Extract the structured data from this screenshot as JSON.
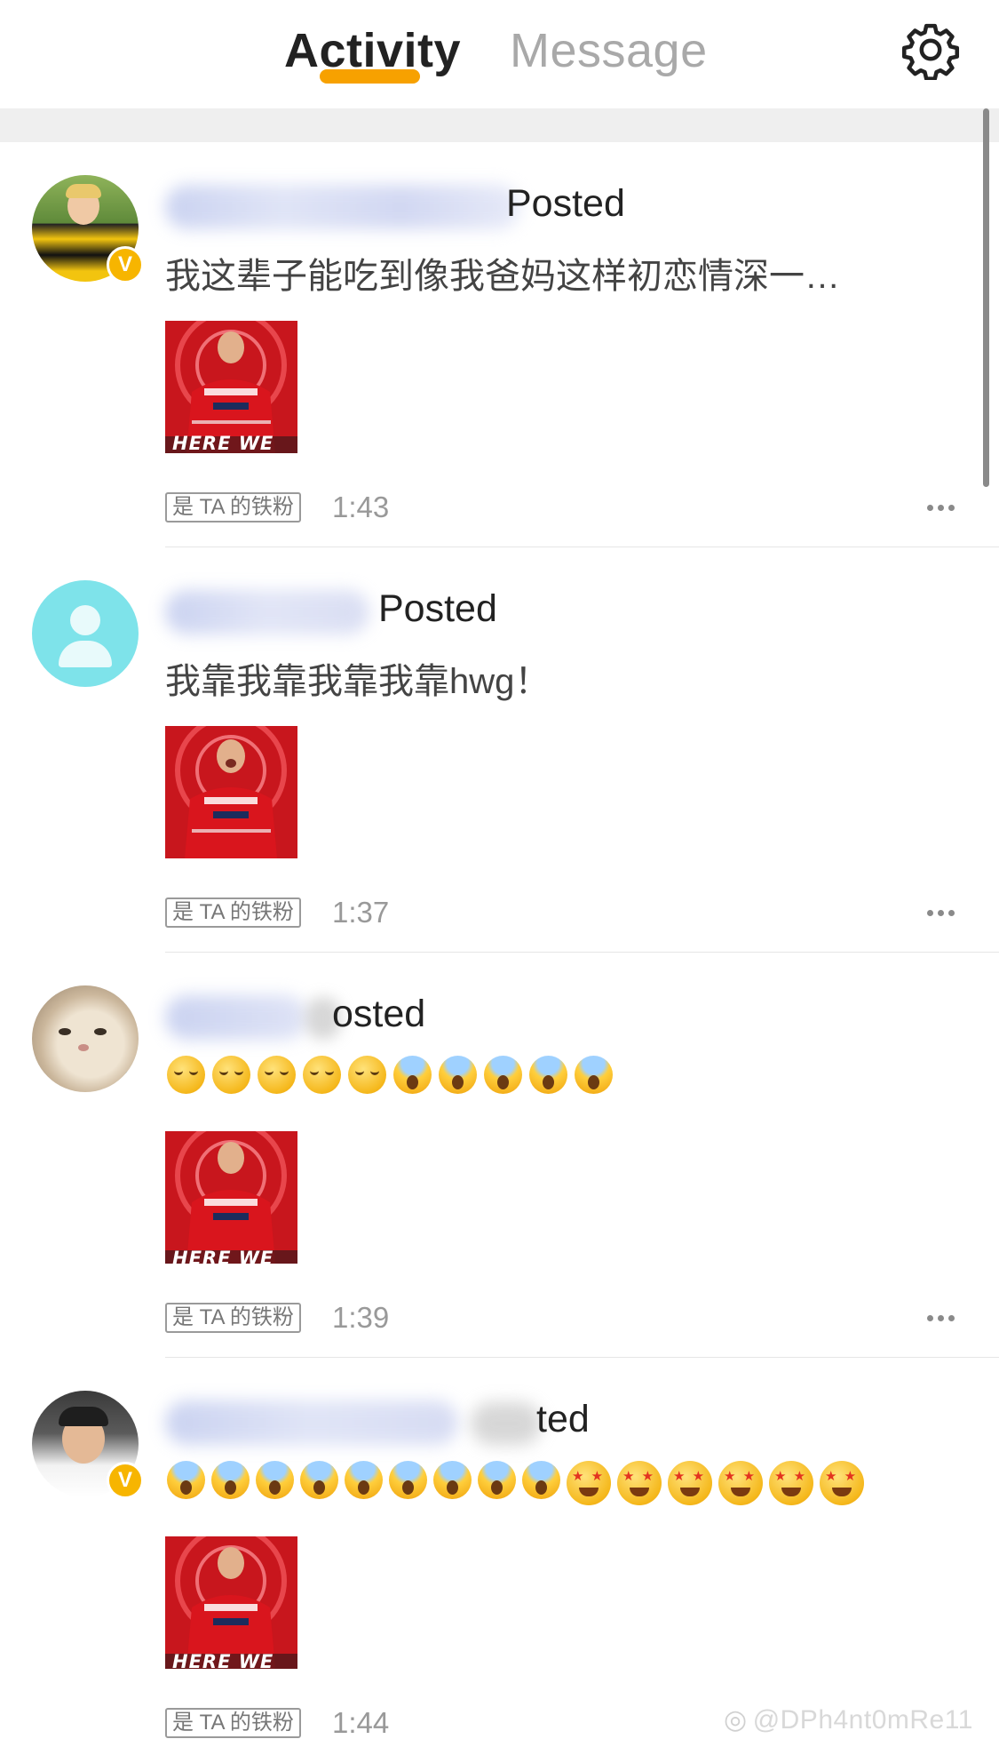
{
  "header": {
    "tabs": [
      {
        "label": "Activity",
        "active": true
      },
      {
        "label": "Message",
        "active": false
      }
    ],
    "settings_icon": "gear-icon",
    "accent_color": "#f7a100"
  },
  "feed": [
    {
      "action": "Posted",
      "content": "我这辈子能吃到像我爸妈这样初恋情深一…",
      "verified": true,
      "fan_badge": "是 TA 的铁粉",
      "time": "1:43",
      "thumb_caption": "HERE WE GO"
    },
    {
      "action": "Posted",
      "content": "我靠我靠我靠我靠hwg！",
      "verified": false,
      "fan_badge": "是 TA 的铁粉",
      "time": "1:37",
      "thumb_caption": ""
    },
    {
      "action": "osted",
      "content_emojis": [
        "crying-face",
        "crying-face",
        "crying-face",
        "crying-face",
        "crying-face",
        "screaming-face",
        "screaming-face",
        "screaming-face",
        "screaming-face",
        "screaming-face"
      ],
      "verified": false,
      "fan_badge": "是 TA 的铁粉",
      "time": "1:39",
      "thumb_caption": "HERE WE GO"
    },
    {
      "action": "ted",
      "content_emojis": [
        "fearful-face",
        "fearful-face",
        "fearful-face",
        "fearful-face",
        "fearful-face",
        "fearful-face",
        "fearful-face",
        "fearful-face",
        "fearful-face",
        "star-struck-face",
        "star-struck-face",
        "star-struck-face",
        "star-struck-face",
        "star-struck-face",
        "star-struck-face"
      ],
      "verified": true,
      "fan_badge": "是 TA 的铁粉",
      "time": "1:44",
      "thumb_caption": "HERE WE GO"
    }
  ],
  "watermark": "@DPh4nt0mRe11"
}
